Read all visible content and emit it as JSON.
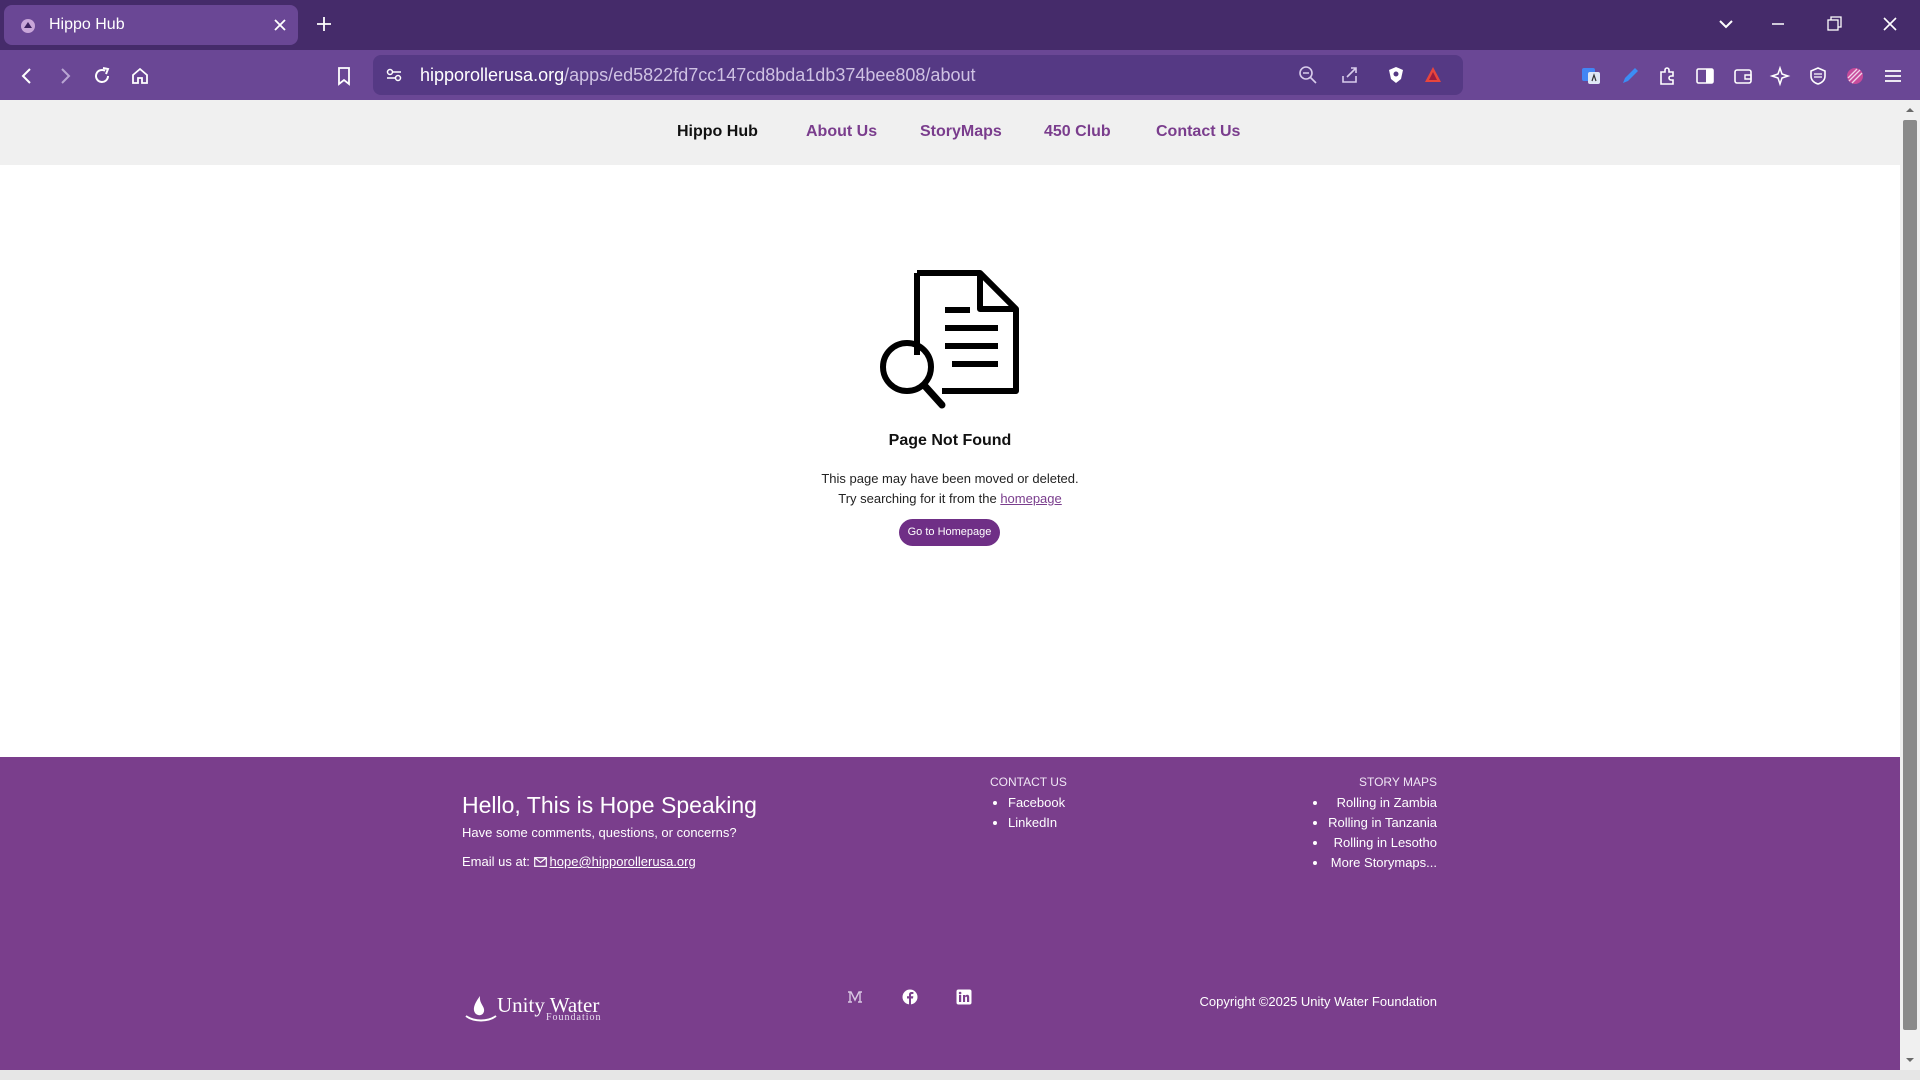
{
  "browser": {
    "tab_title": "Hippo Hub",
    "url_host": "hipporollerusa.org",
    "url_path": "/apps/ed5822fd7cc147cd8bda1db374bee808/about"
  },
  "nav": {
    "brand": "Hippo Hub",
    "items": [
      "About Us",
      "StoryMaps",
      "450 Club",
      "Contact Us"
    ]
  },
  "main": {
    "title": "Page Not Found",
    "line1": "This page may have been moved or deleted.",
    "line2_prefix": "Try searching for it from the ",
    "line2_link": "homepage",
    "button": "Go to Homepage"
  },
  "footer": {
    "title": "Hello, This is Hope Speaking",
    "subtitle": "Have some comments, questions, or concerns?",
    "email_prefix": "Email us at: ",
    "email": "hope@hipporollerusa.org",
    "contact_heading": "CONTACT US",
    "contact_links": [
      "Facebook",
      "LinkedIn"
    ],
    "story_heading": "STORY MAPS",
    "story_links": [
      "Rolling in Zambia",
      "Rolling in Tanzania",
      "Rolling in Lesotho",
      "More Storymaps..."
    ],
    "logo_text": "Unity Water",
    "logo_subtext": "Foundation",
    "copyright": "Copyright ©2025 Unity Water Foundation"
  },
  "colors": {
    "brand_purple": "#7a3e8c",
    "chrome_dark": "#452b6a",
    "chrome_toolbar": "#6a4795",
    "button": "#6f2f86"
  }
}
